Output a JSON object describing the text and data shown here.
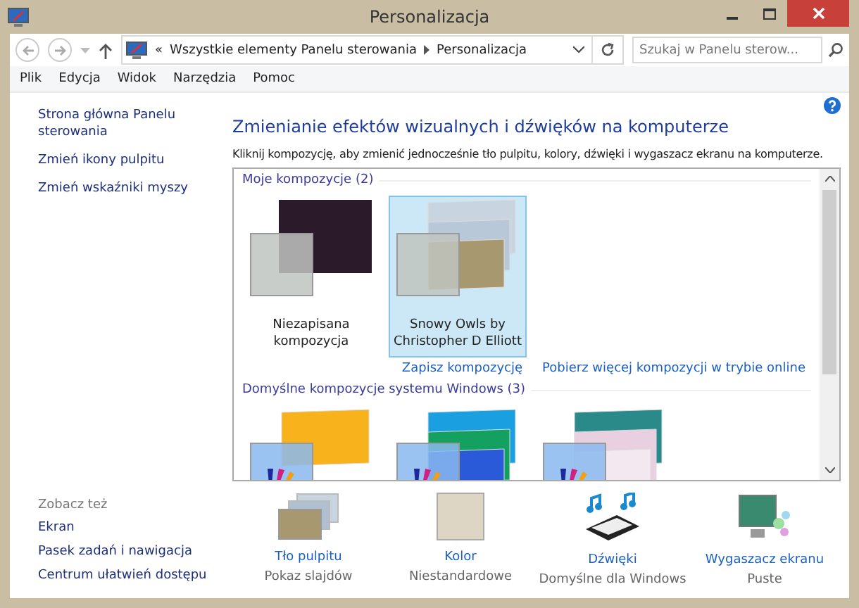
{
  "window": {
    "title": "Personalizacja"
  },
  "address_bar": {
    "crumbs": [
      "«",
      "Wszystkie elementy Panelu sterowania",
      "Personalizacja"
    ]
  },
  "search": {
    "placeholder": "Szukaj w Panelu sterow..."
  },
  "menu": [
    "Plik",
    "Edycja",
    "Widok",
    "Narzędzia",
    "Pomoc"
  ],
  "sidebar": {
    "links": [
      "Strona główna Panelu sterowania",
      "Zmień ikony pulpitu",
      "Zmień wskaźniki myszy"
    ],
    "see_also_title": "Zobacz też",
    "see_also": [
      "Ekran",
      "Pasek zadań i nawigacja",
      "Centrum ułatwień dostępu"
    ]
  },
  "heading": "Zmienianie efektów wizualnych i dźwięków na komputerze",
  "description": "Kliknij kompozycję, aby zmienić jednocześnie tło pulpitu, kolory, dźwięki i wygaszacz ekranu na komputerze.",
  "theme_groups": [
    {
      "title": "Moje kompozycje (2)",
      "themes": [
        {
          "kind": "photo",
          "name": "Niezapisana kompozycja",
          "selected": false
        },
        {
          "kind": "owls",
          "name": "Snowy Owls by Christopher D Elliott",
          "selected": true
        }
      ],
      "links": [
        "Zapisz kompozycję",
        "Pobierz więcej kompozycji w trybie online"
      ]
    },
    {
      "title": "Domyślne kompozycje systemu Windows (3)",
      "themes": [
        {
          "kind": "orange",
          "selected": false
        },
        {
          "kind": "blue",
          "selected": false
        },
        {
          "kind": "flowers",
          "selected": false
        }
      ]
    }
  ],
  "settings": [
    {
      "kind": "wallpaper",
      "label": "Tło pulpitu",
      "value": "Pokaz slajdów"
    },
    {
      "kind": "color",
      "label": "Kolor",
      "value": "Niestandardowe"
    },
    {
      "kind": "sounds",
      "label": "Dźwięki",
      "value": "Domyślne dla Windows"
    },
    {
      "kind": "screensaver",
      "label": "Wygaszacz ekranu",
      "value": "Puste"
    }
  ]
}
